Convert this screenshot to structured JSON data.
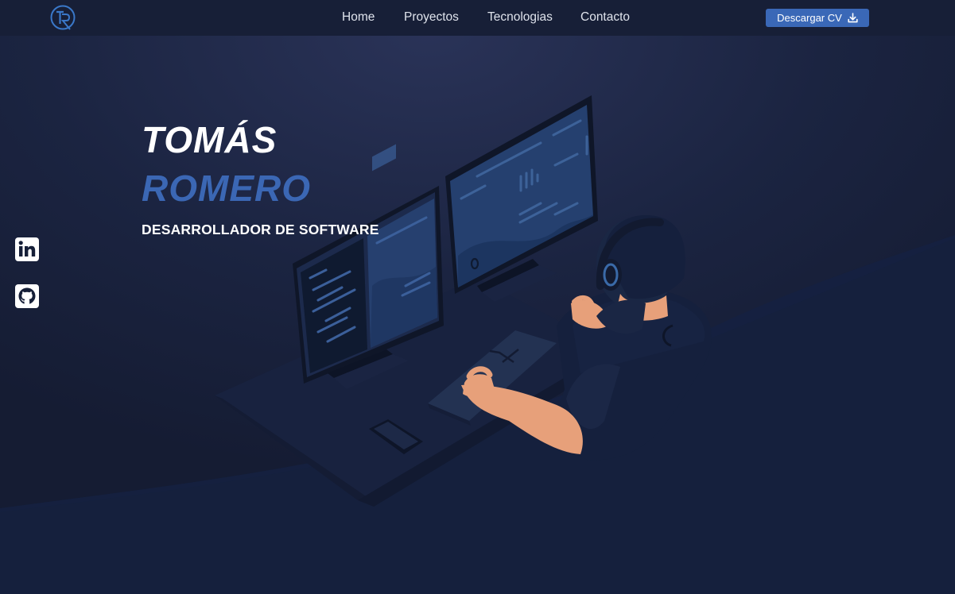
{
  "nav": {
    "links": [
      {
        "label": "Home"
      },
      {
        "label": "Proyectos"
      },
      {
        "label": "Tecnologias"
      },
      {
        "label": "Contacto"
      }
    ],
    "cv_button": {
      "label": "Descargar CV",
      "icon": "download-icon"
    },
    "logo": {
      "text": "TR",
      "icon": "tr-monogram-logo"
    }
  },
  "hero": {
    "first_name": "TOMÁS",
    "last_name": "ROMERO",
    "role": "DESARROLLADOR DE SOFTWARE"
  },
  "social": [
    {
      "name": "linkedin",
      "icon": "linkedin-icon"
    },
    {
      "name": "github",
      "icon": "github-icon"
    }
  ],
  "colors": {
    "background": "#161f38",
    "navbar": "#171f37",
    "accent": "#3b67b4",
    "button": "#3a68b7",
    "text": "#ffffff"
  }
}
